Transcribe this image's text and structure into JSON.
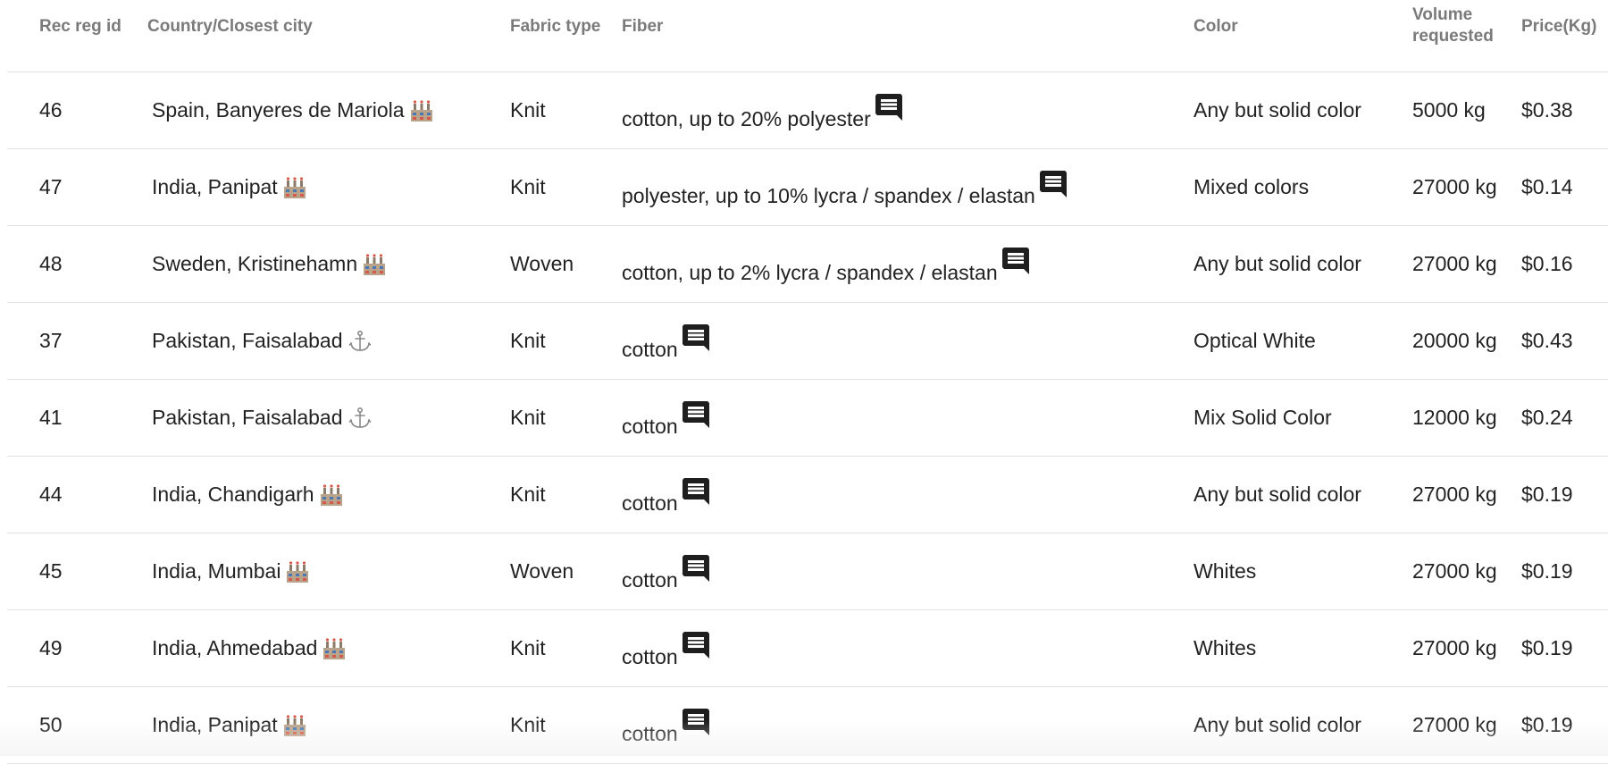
{
  "columns": {
    "rec_reg_id": "Rec reg id",
    "country_city": "Country/Closest city",
    "fabric_type": "Fabric type",
    "fiber": "Fiber",
    "color": "Color",
    "volume_line1": "Volume",
    "volume_line2": "requested",
    "price": "Price(Kg)"
  },
  "rows": [
    {
      "id": "46",
      "location": "Spain, Banyeres de Mariola",
      "location_icon": "factory-icon",
      "fabric": "Knit",
      "fiber": "cotton, up to 20% polyester",
      "color": "Any but solid color",
      "volume": "5000 kg",
      "price": "$0.38"
    },
    {
      "id": "47",
      "location": "India, Panipat",
      "location_icon": "factory-icon",
      "fabric": "Knit",
      "fiber": "polyester, up to 10% lycra / spandex / elastan",
      "color": "Mixed colors",
      "volume": "27000 kg",
      "price": "$0.14"
    },
    {
      "id": "48",
      "location": "Sweden, Kristinehamn ",
      "location_icon": "factory-icon",
      "fabric": "Woven",
      "fiber": "cotton, up to 2% lycra / spandex / elastan",
      "color": "Any but solid color",
      "volume": "27000 kg",
      "price": "$0.16"
    },
    {
      "id": "37",
      "location": "Pakistan, Faisalabad",
      "location_icon": "anchor-icon",
      "fabric": "Knit",
      "fiber": "cotton",
      "color": "Optical White",
      "volume": "20000 kg",
      "price": "$0.43"
    },
    {
      "id": "41",
      "location": "Pakistan, Faisalabad",
      "location_icon": "anchor-icon",
      "fabric": "Knit",
      "fiber": "cotton",
      "color": "Mix Solid Color",
      "volume": "12000 kg",
      "price": "$0.24"
    },
    {
      "id": "44",
      "location": "India, Chandigarh",
      "location_icon": "factory-icon",
      "fabric": "Knit",
      "fiber": "cotton",
      "color": "Any but solid color",
      "volume": "27000 kg",
      "price": "$0.19"
    },
    {
      "id": "45",
      "location": "India, Mumbai",
      "location_icon": "factory-icon",
      "fabric": "Woven",
      "fiber": "cotton",
      "color": "Whites",
      "volume": "27000 kg",
      "price": "$0.19"
    },
    {
      "id": "49",
      "location": "India, Ahmedabad",
      "location_icon": "factory-icon",
      "fabric": "Knit",
      "fiber": "cotton",
      "color": "Whites",
      "volume": "27000 kg",
      "price": "$0.19"
    },
    {
      "id": "50",
      "location": "India, Panipat",
      "location_icon": "factory-icon",
      "fabric": "Knit",
      "fiber": "cotton",
      "color": "Any but solid color",
      "volume": "27000 kg",
      "price": "$0.19"
    }
  ],
  "colors": {
    "header_text": "#7a7a7a",
    "body_text": "#222222",
    "divider": "#e2e2e2",
    "comment_icon": "#1e1e1e"
  }
}
